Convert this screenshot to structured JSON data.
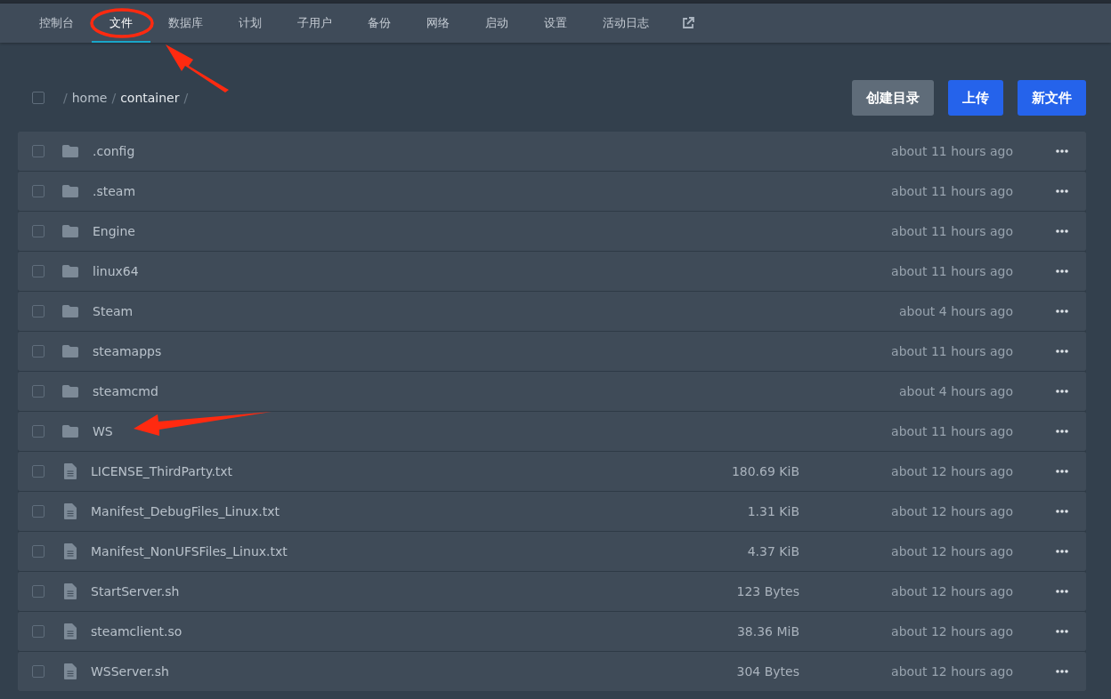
{
  "tabs": [
    {
      "label": "控制台",
      "selected": false
    },
    {
      "label": "文件",
      "selected": true
    },
    {
      "label": "数据库",
      "selected": false
    },
    {
      "label": "计划",
      "selected": false
    },
    {
      "label": "子用户",
      "selected": false
    },
    {
      "label": "备份",
      "selected": false
    },
    {
      "label": "网络",
      "selected": false
    },
    {
      "label": "启动",
      "selected": false
    },
    {
      "label": "设置",
      "selected": false
    },
    {
      "label": "活动日志",
      "selected": false
    }
  ],
  "select_all": {
    "checked": false
  },
  "breadcrumb": [
    {
      "kind": "separator",
      "text": "/"
    },
    {
      "kind": "link",
      "text": "home"
    },
    {
      "kind": "separator",
      "text": "/"
    },
    {
      "kind": "current",
      "text": "container"
    },
    {
      "kind": "separator",
      "text": "/"
    }
  ],
  "buttons": [
    {
      "label": "创建目录",
      "kind": "secondary"
    },
    {
      "label": "上传",
      "kind": "primary"
    },
    {
      "label": "新文件",
      "kind": "primary"
    }
  ],
  "files": [
    {
      "kind": "folder",
      "name": ".config",
      "modified": "about 11 hours ago",
      "checked": false
    },
    {
      "kind": "folder",
      "name": ".steam",
      "modified": "about 11 hours ago",
      "checked": false
    },
    {
      "kind": "folder",
      "name": "Engine",
      "modified": "about 11 hours ago",
      "checked": false
    },
    {
      "kind": "folder",
      "name": "linux64",
      "modified": "about 11 hours ago",
      "checked": false
    },
    {
      "kind": "folder",
      "name": "Steam",
      "modified": "about 4 hours ago",
      "checked": false
    },
    {
      "kind": "folder",
      "name": "steamapps",
      "modified": "about 11 hours ago",
      "checked": false
    },
    {
      "kind": "folder",
      "name": "steamcmd",
      "modified": "about 4 hours ago",
      "checked": false
    },
    {
      "kind": "folder",
      "name": "WS",
      "modified": "about 11 hours ago",
      "checked": false
    },
    {
      "kind": "file",
      "name": "LICENSE_ThirdParty.txt",
      "size": "180.69 KiB",
      "modified": "about 12 hours ago",
      "checked": false
    },
    {
      "kind": "file",
      "name": "Manifest_DebugFiles_Linux.txt",
      "size": "1.31 KiB",
      "modified": "about 12 hours ago",
      "checked": false
    },
    {
      "kind": "file",
      "name": "Manifest_NonUFSFiles_Linux.txt",
      "size": "4.37 KiB",
      "modified": "about 12 hours ago",
      "checked": false
    },
    {
      "kind": "file",
      "name": "StartServer.sh",
      "size": "123 Bytes",
      "modified": "about 12 hours ago",
      "checked": false
    },
    {
      "kind": "file",
      "name": "steamclient.so",
      "size": "38.36 MiB",
      "modified": "about 12 hours ago",
      "checked": false
    },
    {
      "kind": "file",
      "name": "WSServer.sh",
      "size": "304 Bytes",
      "modified": "about 12 hours ago",
      "checked": false
    }
  ]
}
